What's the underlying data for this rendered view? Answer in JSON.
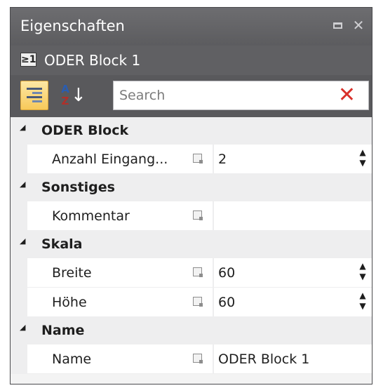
{
  "window": {
    "title": "Eigenschaften",
    "controls": {
      "restore_icon": "restore-icon",
      "close_icon": "close-icon",
      "close_glyph": "✕"
    }
  },
  "object": {
    "icon_glyph": "≥1",
    "name": "ODER Block 1"
  },
  "toolbar": {
    "categorized_icon": "categorized-view-icon",
    "sort_icon": "sort-alphabetical-icon",
    "sort_a": "A",
    "sort_z": "Z",
    "sort_arrow": "↓",
    "search_placeholder": "Search",
    "search_value": "",
    "clear_glyph": "✕"
  },
  "categories": [
    {
      "label": "ODER Block",
      "props": [
        {
          "name": "Anzahl Eingang...",
          "value": "2",
          "spinner": true
        }
      ]
    },
    {
      "label": "Sonstiges",
      "props": [
        {
          "name": "Kommentar",
          "value": "",
          "spinner": false
        }
      ]
    },
    {
      "label": "Skala",
      "props": [
        {
          "name": "Breite",
          "value": "60",
          "spinner": true
        },
        {
          "name": "Höhe",
          "value": "60",
          "spinner": true
        }
      ]
    },
    {
      "label": "Name",
      "props": [
        {
          "name": "Name",
          "value": "ODER Block 1",
          "spinner": false
        }
      ]
    }
  ],
  "glyphs": {
    "expand": "◢",
    "spin_up": "▲",
    "spin_down": "▼"
  },
  "colors": {
    "titlebar": "#5c5c5f",
    "accent_button": "#f7c95a",
    "clear_red": "#d9302a",
    "grid_bg": "#f3f3f3"
  }
}
